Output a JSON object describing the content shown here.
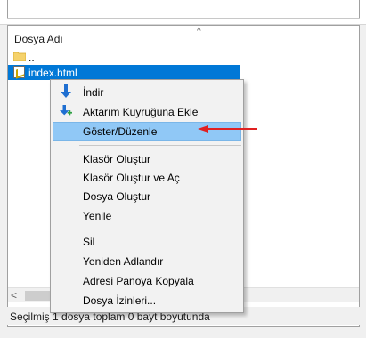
{
  "file_panel": {
    "column_header": "Dosya Adı",
    "rows": [
      {
        "name": "..",
        "icon": "folder-icon"
      },
      {
        "name": "index.html",
        "icon": "html-file-icon"
      }
    ]
  },
  "context_menu": {
    "items": [
      {
        "label": "İndir",
        "icon": "download-icon"
      },
      {
        "label": "Aktarım Kuyruğuna Ekle",
        "icon": "add-to-queue-icon"
      },
      {
        "label": "Göster/Düzenle"
      },
      {
        "label": "Klasör Oluştur"
      },
      {
        "label": "Klasör Oluştur ve Aç"
      },
      {
        "label": "Dosya Oluştur"
      },
      {
        "label": "Yenile"
      },
      {
        "label": "Sil"
      },
      {
        "label": "Yeniden Adlandır"
      },
      {
        "label": "Adresi Panoya Kopyala"
      },
      {
        "label": "Dosya İzinleri..."
      }
    ]
  },
  "status_bar": {
    "text": "Seçilmiş 1 dosya toplam 0 bayt boyutunda"
  },
  "colors": {
    "selection": "#0078d7",
    "menu_highlight": "#90c8f6",
    "annotation_arrow": "#e02020",
    "download_icon": "#1f6fd1",
    "add_plus": "#2ea043"
  }
}
